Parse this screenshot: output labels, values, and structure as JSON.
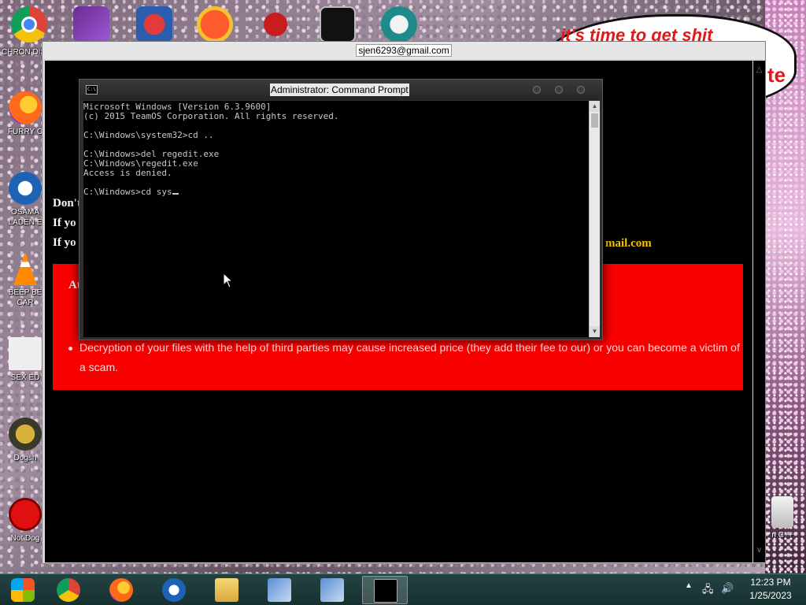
{
  "desktop": {
    "bubble_text": "it's time to get shit",
    "bubble_tail": "te",
    "icons": [
      {
        "label": "CHRON\nDISEA",
        "icon": "chrome-icon"
      },
      {
        "label": "FURRY C",
        "icon": "firefox-icon"
      },
      {
        "label": "OSAMA\nLADEN E",
        "icon": "obama-logo-icon"
      },
      {
        "label": "BEEP BE\nCAR",
        "icon": "traffic-cone-icon"
      },
      {
        "label": "SEX ED",
        "icon": "hx-icon"
      },
      {
        "label": "Dogsh",
        "icon": "dogsh-icon"
      },
      {
        "label": "Not Dog",
        "icon": "devcpp-icon"
      }
    ],
    "right_icon_label": "n C++",
    "top_icons": [
      "chrome-icon",
      "visual-studio-icon",
      "v2-icon",
      "p-icon",
      "red-bird-icon",
      "cmd-icon",
      "santa-icon"
    ]
  },
  "ransom": {
    "title": "sjen6293@gmail.com",
    "lines": [
      "Don't",
      "If yo",
      "If yo"
    ],
    "email_fragment": "mail.com",
    "red_heading": "At",
    "bullet": "Decryption of your files with the help of third parties may cause increased price (they add their fee to our) or you can become a victim of a scam."
  },
  "cmd": {
    "title": "Administrator: Command Prompt",
    "lines": [
      "Microsoft Windows [Version 6.3.9600]",
      "(c) 2015 TeamOS Corporation. All rights reserved.",
      "",
      "C:\\Windows\\system32>cd ..",
      "",
      "C:\\Windows>del regedit.exe",
      "C:\\Windows\\regedit.exe",
      "Access is denied.",
      "",
      "C:\\Windows>cd sys"
    ]
  },
  "taskbar": {
    "apps": [
      "windows-start-icon",
      "chrome-icon",
      "firefox-icon",
      "obama-logo-icon",
      "file-explorer-icon",
      "installer-icon",
      "installer-icon",
      "cmd-icon"
    ],
    "time": "12:23 PM",
    "date": "1/25/2023"
  },
  "colors": {
    "ransom_red": "#f70000",
    "email_yellow": "#f5c400",
    "taskbar": "#1e3b3a"
  }
}
